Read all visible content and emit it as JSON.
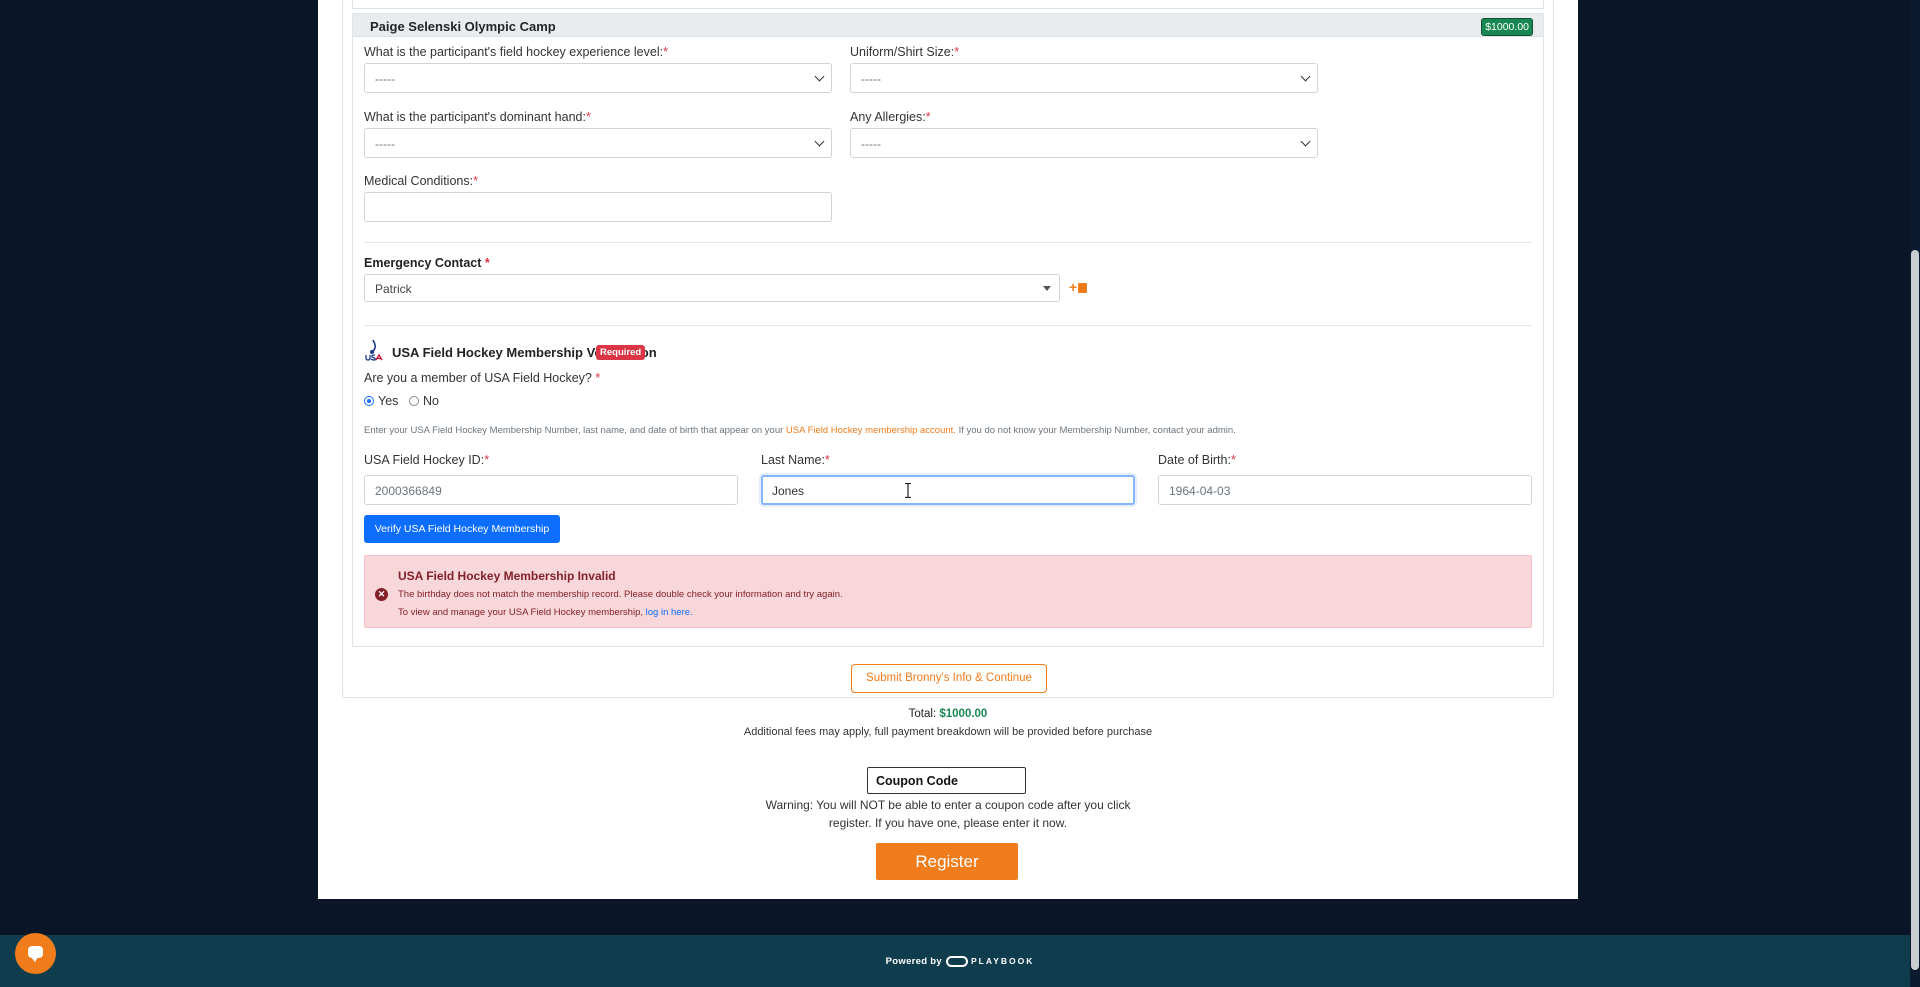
{
  "camp": {
    "title": "Paige Selenski Olympic Camp",
    "price": "$1000.00"
  },
  "questions": {
    "experience_label": "What is the participant's field hockey experience level:",
    "experience_value": "-----",
    "shirt_label": "Uniform/Shirt Size:",
    "shirt_value": "-----",
    "hand_label": "What is the participant's dominant hand:",
    "hand_value": "-----",
    "allergies_label": "Any Allergies:",
    "allergies_value": "-----",
    "medical_label": "Medical Conditions:",
    "medical_value": "",
    "required_mark": "*"
  },
  "emergency": {
    "label": "Emergency Contact",
    "value": "Patrick"
  },
  "verification": {
    "title": "USA Field Hockey Membership Verification",
    "badge": "Required",
    "question": "Are you a member of USA Field Hockey?",
    "yes": "Yes",
    "no": "No",
    "selected": "Yes",
    "help_pre": "Enter your USA Field Hockey Membership Number, last name, and date of birth that appear on your",
    "help_link": "USA Field Hockey membership account.",
    "help_post": "If you do not know your Membership Number, contact your admin.",
    "id_label": "USA Field Hockey ID:",
    "id_value": "2000366849",
    "last_label": "Last Name:",
    "last_value": "Jones",
    "dob_label": "Date of Birth:",
    "dob_value": "1964-04-03",
    "verify_button": "Verify USA Field Hockey Membership"
  },
  "alert": {
    "title": "USA Field Hockey Membership Invalid",
    "line1": "The birthday does not match the membership record. Please double check your information and try again.",
    "line2_pre": "To view and manage your USA Field Hockey membership,",
    "line2_link": "log in here."
  },
  "submit_button": "Submit Bronny's Info & Continue",
  "total": {
    "label": "Total:",
    "amount": "$1000.00",
    "fees_note": "Additional fees may apply, full payment breakdown will be provided before purchase"
  },
  "coupon": {
    "placeholder": "Coupon Code",
    "warning_line1": "Warning: You will NOT be able to enter a coupon code after you click",
    "warning_line2": "register. If you have one, please enter it now."
  },
  "register_button": "Register",
  "footer": {
    "powered_by": "Powered by",
    "brand": "PLAYBOOK"
  },
  "colors": {
    "accent": "#f07c1b",
    "primary": "#0d6efd",
    "success": "#198754",
    "danger": "#dc3545",
    "page_bg": "#0a1628",
    "footer_bg": "#0f3d4d"
  }
}
